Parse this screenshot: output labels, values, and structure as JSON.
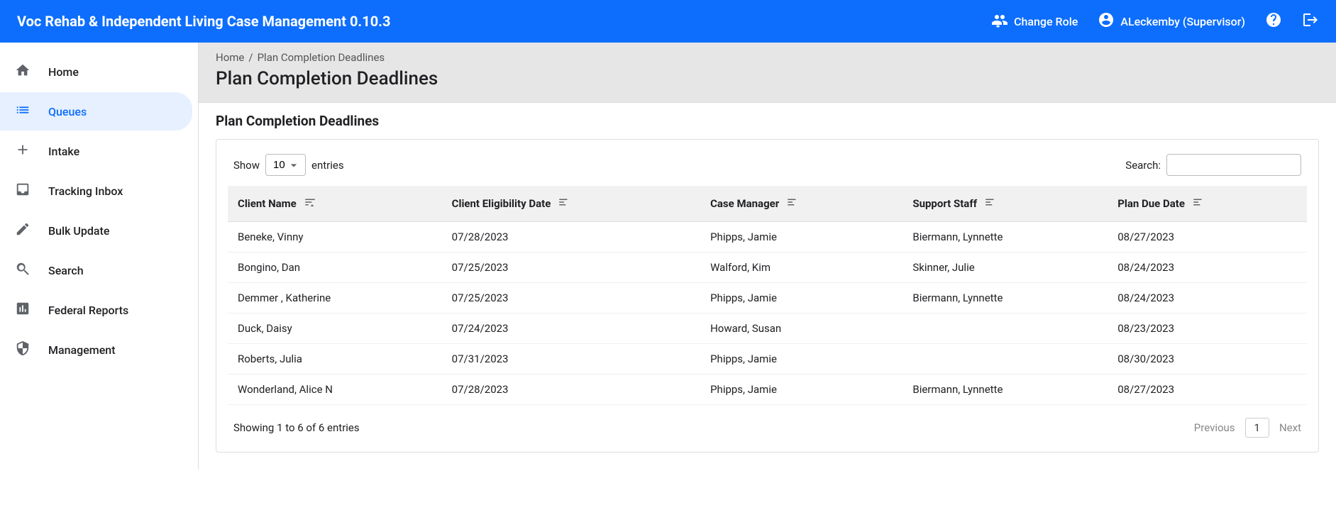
{
  "header": {
    "app_title": "Voc Rehab & Independent Living Case Management 0.10.3",
    "change_role_label": "Change Role",
    "user_display": "ALeckemby (Supervisor)"
  },
  "sidebar": {
    "items": [
      {
        "id": "home",
        "label": "Home"
      },
      {
        "id": "queues",
        "label": "Queues"
      },
      {
        "id": "intake",
        "label": "Intake"
      },
      {
        "id": "tracking-inbox",
        "label": "Tracking Inbox"
      },
      {
        "id": "bulk-update",
        "label": "Bulk Update"
      },
      {
        "id": "search",
        "label": "Search"
      },
      {
        "id": "federal-reports",
        "label": "Federal Reports"
      },
      {
        "id": "management",
        "label": "Management"
      }
    ]
  },
  "breadcrumbs": {
    "home": "Home",
    "sep": "/",
    "current": "Plan Completion Deadlines"
  },
  "page": {
    "title": "Plan Completion Deadlines",
    "panel_title": "Plan Completion Deadlines"
  },
  "table": {
    "show_label_pre": "Show",
    "show_label_post": "entries",
    "show_value": "10",
    "search_label": "Search:",
    "search_value": "",
    "columns": [
      "Client Name",
      "Client Eligibility Date",
      "Case Manager",
      "Support Staff",
      "Plan Due Date"
    ],
    "rows": [
      {
        "client_name": "Beneke, Vinny",
        "eligibility_date": "07/28/2023",
        "case_manager": "Phipps, Jamie",
        "support_staff": "Biermann, Lynnette",
        "plan_due": "08/27/2023"
      },
      {
        "client_name": "Bongino, Dan",
        "eligibility_date": "07/25/2023",
        "case_manager": "Walford, Kim",
        "support_staff": "Skinner, Julie",
        "plan_due": "08/24/2023"
      },
      {
        "client_name": "Demmer , Katherine",
        "eligibility_date": "07/25/2023",
        "case_manager": "Phipps, Jamie",
        "support_staff": "Biermann, Lynnette",
        "plan_due": "08/24/2023"
      },
      {
        "client_name": "Duck, Daisy",
        "eligibility_date": "07/24/2023",
        "case_manager": "Howard, Susan",
        "support_staff": "",
        "plan_due": "08/23/2023"
      },
      {
        "client_name": "Roberts, Julia",
        "eligibility_date": "07/31/2023",
        "case_manager": "Phipps, Jamie",
        "support_staff": "",
        "plan_due": "08/30/2023"
      },
      {
        "client_name": "Wonderland, Alice N",
        "eligibility_date": "07/28/2023",
        "case_manager": "Phipps, Jamie",
        "support_staff": "Biermann, Lynnette",
        "plan_due": "08/27/2023"
      }
    ],
    "footer_info": "Showing 1 to 6 of 6 entries",
    "pager": {
      "prev": "Previous",
      "page": "1",
      "next": "Next"
    }
  }
}
